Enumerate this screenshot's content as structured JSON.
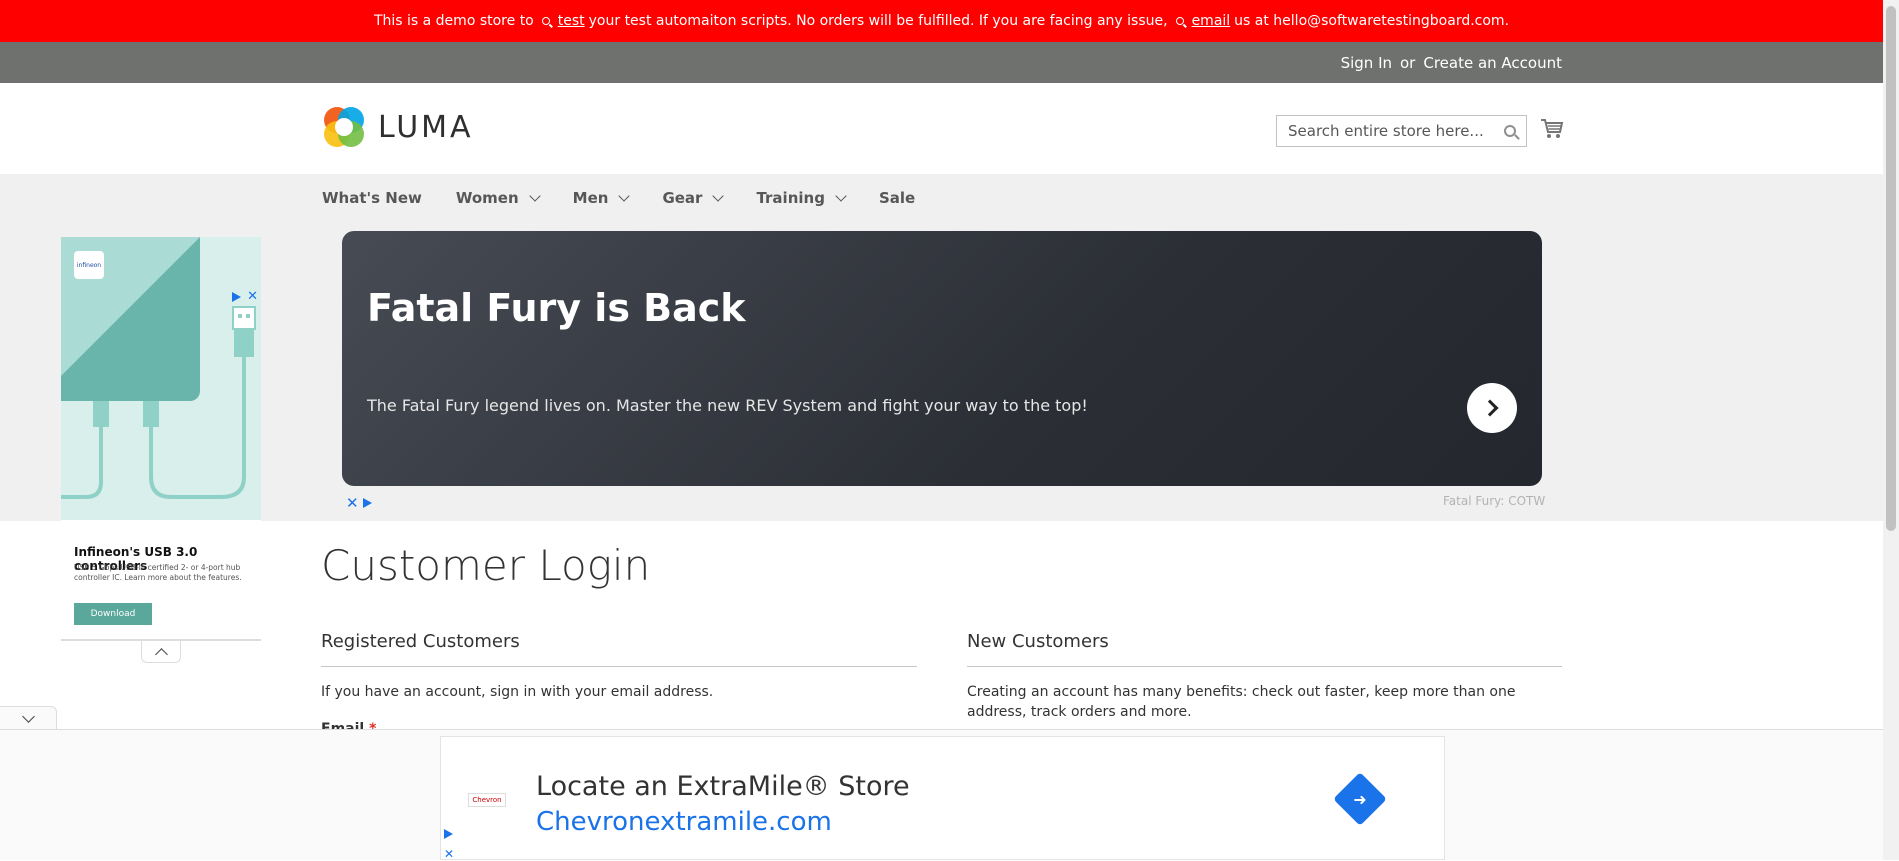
{
  "demo_banner": {
    "text_1": "This is a demo store to",
    "link_1": "test",
    "text_2": "your test automaiton scripts. No orders will be fulfilled. If you are facing any issue,",
    "link_2": "email",
    "text_3": "us at hello@softwaretestingboard.com."
  },
  "panel": {
    "sign_in": "Sign In",
    "or": "or",
    "create_account": "Create an Account"
  },
  "logo": {
    "text": "LUMA"
  },
  "search": {
    "placeholder": "Search entire store here..."
  },
  "nav": {
    "items": [
      {
        "label": "What's New"
      },
      {
        "label": "Women"
      },
      {
        "label": "Men"
      },
      {
        "label": "Gear"
      },
      {
        "label": "Training"
      },
      {
        "label": "Sale"
      }
    ]
  },
  "hero_ad": {
    "title": "Fatal Fury is Back",
    "body": "The Fatal Fury legend lives on. Master the new REV System and fight your way to the top!",
    "caption": "Fatal Fury: COTW"
  },
  "side_ad": {
    "logo_text": "infineon",
    "title": "Infineon's USB 3.0 controllers",
    "description": "USB 5 Gbps USB-IF certified 2- or 4-port hub controller IC. Learn more about the features.",
    "button": "Download"
  },
  "main": {
    "page_title": "Customer Login",
    "registered": {
      "title": "Registered Customers",
      "text": "If you have an account, sign in with your email address.",
      "email_label": "Email",
      "required_mark": "*"
    },
    "new_customers": {
      "title": "New Customers",
      "text": "Creating an account has many benefits: check out faster, keep more than one address, track orders and more."
    }
  },
  "bottom_ad": {
    "brand": "Chevron",
    "headline": "Locate an ExtraMile® Store",
    "url": "Chevronextramile.com"
  }
}
